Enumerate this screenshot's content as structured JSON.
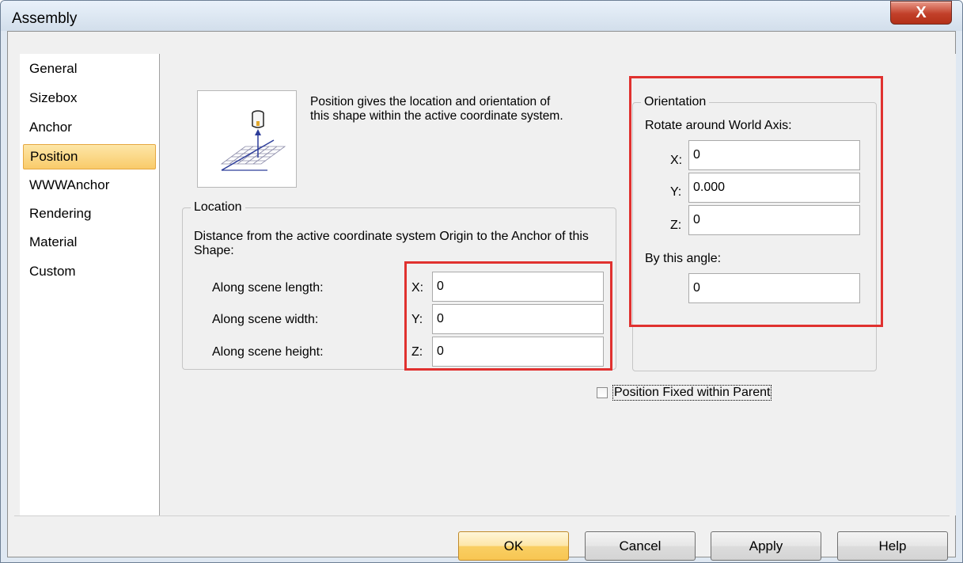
{
  "window": {
    "title": "Assembly",
    "close_label": "X"
  },
  "sidebar": {
    "items": [
      {
        "label": "General",
        "selected": false
      },
      {
        "label": "Sizebox",
        "selected": false
      },
      {
        "label": "Anchor",
        "selected": false
      },
      {
        "label": "Position",
        "selected": true
      },
      {
        "label": "WWWAnchor",
        "selected": false
      },
      {
        "label": "Rendering",
        "selected": false
      },
      {
        "label": "Material",
        "selected": false
      },
      {
        "label": "Custom",
        "selected": false
      }
    ]
  },
  "position": {
    "description": "Position gives the location and orientation of this shape within the active coordinate system.",
    "location": {
      "legend": "Location",
      "note": "Distance from the active coordinate system Origin to the Anchor of this Shape:",
      "rows": [
        {
          "label": "Along scene length:",
          "axis": "X:",
          "value": "0"
        },
        {
          "label": "Along scene width:",
          "axis": "Y:",
          "value": "0"
        },
        {
          "label": "Along scene height:",
          "axis": "Z:",
          "value": "0"
        }
      ]
    },
    "orientation": {
      "legend": "Orientation",
      "rotate_label": "Rotate around World Axis:",
      "rows": [
        {
          "axis": "X:",
          "value": "0"
        },
        {
          "axis": "Y:",
          "value": "0.000"
        },
        {
          "axis": "Z:",
          "value": "0"
        }
      ],
      "angle_label": "By this angle:",
      "angle_value": "0"
    },
    "fixed_checkbox": {
      "label": "Position Fixed within Parent",
      "checked": false
    }
  },
  "buttons": {
    "ok": "OK",
    "cancel": "Cancel",
    "apply": "Apply",
    "help": "Help"
  },
  "colors": {
    "highlight": "#e0312f",
    "selection": "#f9cb6a",
    "close": "#c2402a"
  }
}
